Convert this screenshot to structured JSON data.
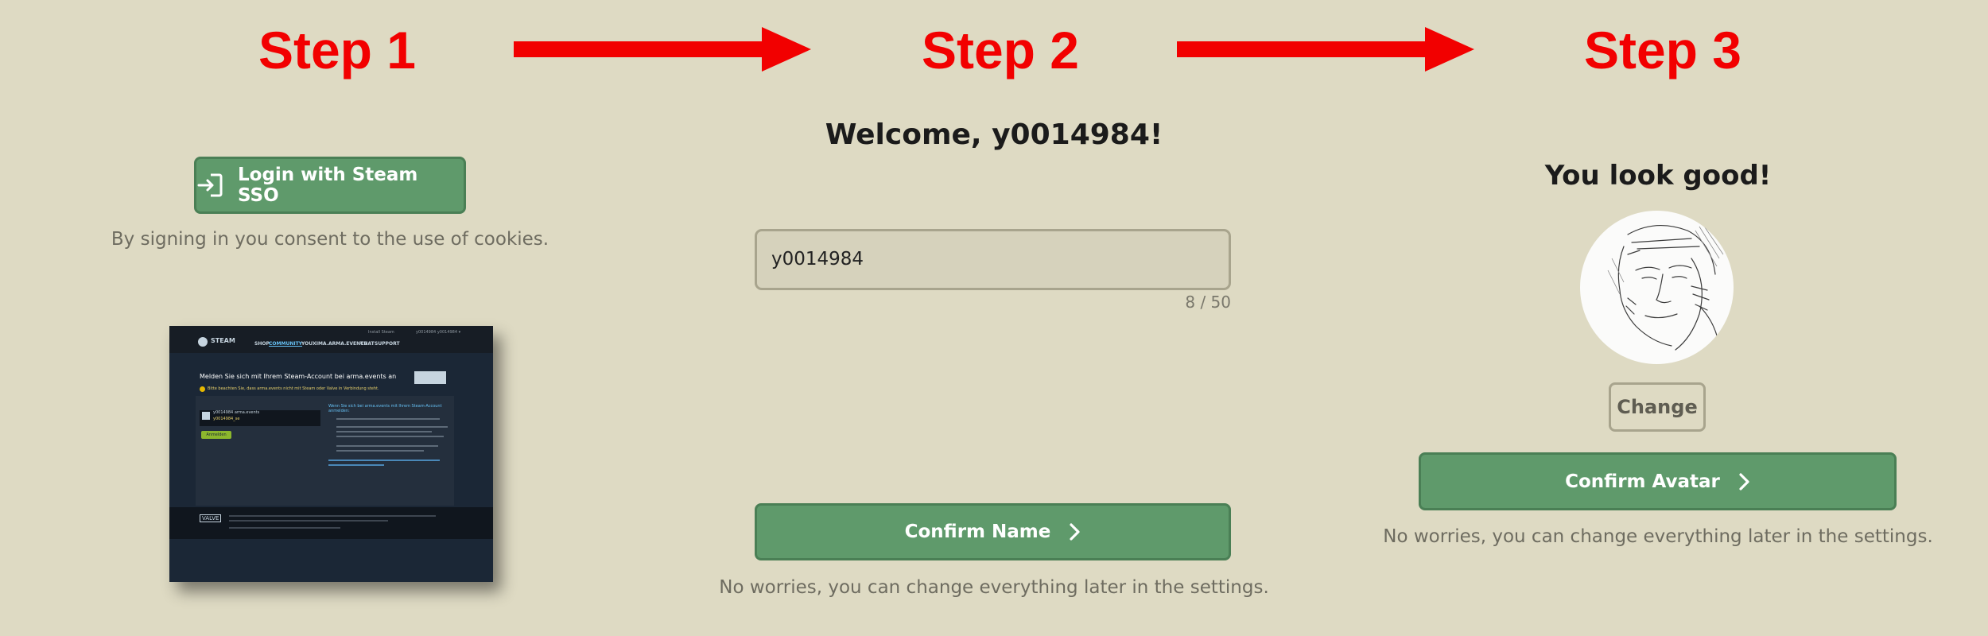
{
  "steps": [
    {
      "label": "Step 1"
    },
    {
      "label": "Step 2"
    },
    {
      "label": "Step 3"
    }
  ],
  "step1": {
    "login_button_label": "Login with Steam SSO",
    "consent_text": "By signing in you consent to the use of cookies.",
    "steam_screenshot": {
      "logo_text": "STEAM",
      "nav_items": [
        "SHOP",
        "COMMUNITY",
        "YOUXIMA.ARMA.EVENTS",
        "CHAT",
        "SUPPORT"
      ],
      "header_right": [
        "Install Steam",
        "y0014984 y0014984 ▾"
      ],
      "panel_title": "Melden Sie sich mit Ihrem Steam-Account bei arma.events an",
      "panel_warning": "Bitte beachten Sie, dass arma.events nicht mit Steam oder Valve in Verbindung steht.",
      "account_name": "y0014984 arma.events",
      "account_sub": "y0014984_se",
      "login_button": "Anmelden",
      "right_heading": "Wenn Sie sich bei arma.events mit Ihrem Steam-Account anmelden:",
      "footer_text": "VALVE"
    }
  },
  "step2": {
    "welcome_heading": "Welcome, y0014984!",
    "name_value": "y0014984",
    "char_count": "8 / 50",
    "confirm_label": "Confirm Name",
    "note": "No worries, you can change everything later in the settings."
  },
  "step3": {
    "heading": "You look good!",
    "change_label": "Change",
    "confirm_label": "Confirm Avatar",
    "note": "No worries, you can change everything later in the settings."
  },
  "colors": {
    "background": "#dedac3",
    "accent_red": "#f20000",
    "button_green": "#5f9a6b",
    "text_muted": "#6e6c60"
  }
}
